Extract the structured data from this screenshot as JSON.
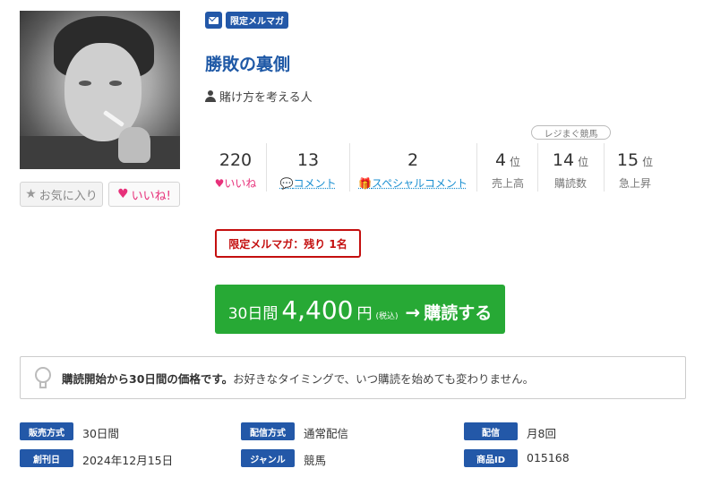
{
  "profile": {
    "fav_label": "お気に入り",
    "like_label": "いいね!"
  },
  "badges": {
    "mail_icon": "envelope-icon",
    "limited": "限定メルマガ"
  },
  "title": "勝敗の裏側",
  "author": "賭け方を考える人",
  "stats": {
    "likes": {
      "value": "220",
      "label": "いいね"
    },
    "comments": {
      "value": "13",
      "label": "コメント"
    },
    "special": {
      "value": "2",
      "label": "スペシャルコメント"
    }
  },
  "ranking": {
    "pill": "レジまぐ競馬",
    "sales": {
      "value": "4",
      "unit": "位",
      "label": "売上高"
    },
    "subs": {
      "value": "14",
      "unit": "位",
      "label": "購読数"
    },
    "rise": {
      "value": "15",
      "unit": "位",
      "label": "急上昇"
    }
  },
  "limited_notice": "限定メルマガ：残り 1名",
  "subscribe": {
    "period": "30日間",
    "price": "4,400",
    "yen": "円",
    "tax": "(税込)",
    "cta": "購読する"
  },
  "info": {
    "bold": "購読開始から30日間の価格です。",
    "text": "お好きなタイミングで、いつ購読を始めても変わりません。"
  },
  "meta": [
    {
      "tag": "販売方式",
      "value": "30日間"
    },
    {
      "tag": "配信方式",
      "value": "通常配信"
    },
    {
      "tag": "配信",
      "value": "月8回"
    },
    {
      "tag": "創刊日",
      "value": "2024年12月15日"
    },
    {
      "tag": "ジャンル",
      "value": "競馬"
    },
    {
      "tag": "商品ID",
      "value": "015168"
    }
  ],
  "colors": {
    "brand": "#2358a8",
    "title": "#1f59a6",
    "pink": "#e7317a",
    "link": "#1a8fd1",
    "cta": "#27a935",
    "alert": "#c40f0f"
  }
}
